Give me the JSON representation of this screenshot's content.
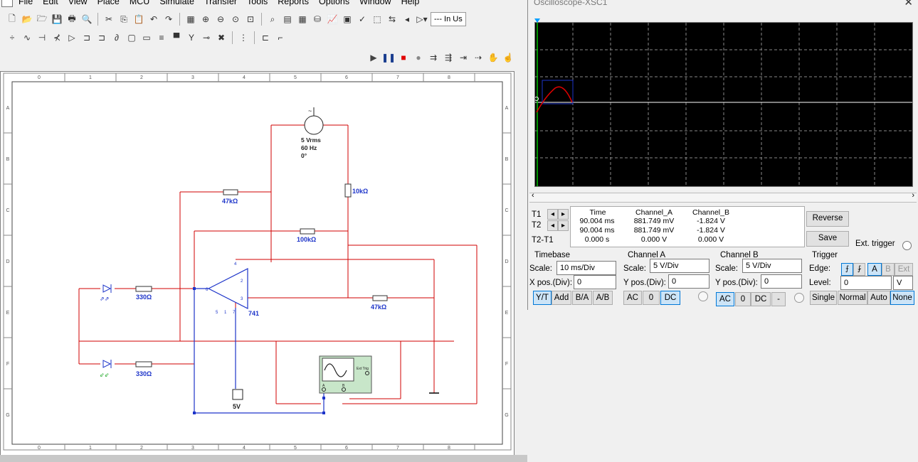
{
  "menu": {
    "items": [
      "File",
      "Edit",
      "View",
      "Place",
      "MCU",
      "Simulate",
      "Transfer",
      "Tools",
      "Reports",
      "Options",
      "Window",
      "Help"
    ]
  },
  "toolbar": {
    "in_use_label": "--- In Us"
  },
  "sheet": {
    "ruler_cols": [
      "0",
      "1",
      "2",
      "3",
      "4",
      "5",
      "6",
      "7",
      "8"
    ],
    "ruler_rows": [
      "A",
      "B",
      "C",
      "D",
      "E",
      "F",
      "G"
    ]
  },
  "circuit": {
    "source_vrms": "5 Vrms",
    "source_freq": "60 Hz",
    "source_phase": "0°",
    "r_10k": "10kΩ",
    "r_47k_top": "47kΩ",
    "r_100k": "100kΩ",
    "r_47k_right": "47kΩ",
    "r_330_top": "330Ω",
    "r_330_bottom": "330Ω",
    "opamp": "741",
    "supply": "5V",
    "scope_ext_trig": "Ext Trig",
    "scope_a": "A",
    "scope_b": "B"
  },
  "oscilloscope": {
    "title": "Oscilloscope-XSC1",
    "readout": {
      "headers": [
        "Time",
        "Channel_A",
        "Channel_B"
      ],
      "rows": [
        {
          "label": "T1",
          "time": "90.004 ms",
          "a": "881.749 mV",
          "b": "-1.824 V"
        },
        {
          "label": "T2",
          "time": "90.004 ms",
          "a": "881.749 mV",
          "b": "-1.824 V"
        },
        {
          "label": "T2-T1",
          "time": "0.000 s",
          "a": "0.000 V",
          "b": "0.000 V"
        }
      ]
    },
    "buttons": {
      "reverse": "Reverse",
      "save": "Save",
      "ext_trigger": "Ext. trigger"
    },
    "timebase": {
      "title": "Timebase",
      "scale_label": "Scale:",
      "scale": "10 ms/Div",
      "xpos_label": "X pos.(Div):",
      "xpos": "0",
      "modes": [
        "Y/T",
        "Add",
        "B/A",
        "A/B"
      ]
    },
    "channel_a": {
      "title": "Channel A",
      "scale_label": "Scale:",
      "scale": "5  V/Div",
      "ypos_label": "Y pos.(Div):",
      "ypos": "0",
      "coupling": [
        "AC",
        "0",
        "DC"
      ]
    },
    "channel_b": {
      "title": "Channel B",
      "scale_label": "Scale:",
      "scale": "5  V/Div",
      "ypos_label": "Y pos.(Div):",
      "ypos": "0",
      "coupling": [
        "AC",
        "0",
        "DC",
        "-"
      ]
    },
    "trigger": {
      "title": "Trigger",
      "edge_label": "Edge:",
      "level_label": "Level:",
      "level": "0",
      "level_unit": "V",
      "sources": [
        "A",
        "B",
        "Ext"
      ],
      "modes": [
        "Single",
        "Normal",
        "Auto",
        "None"
      ]
    },
    "trace_a_color": "#ffffff",
    "trace_b_color": "#e00000"
  }
}
